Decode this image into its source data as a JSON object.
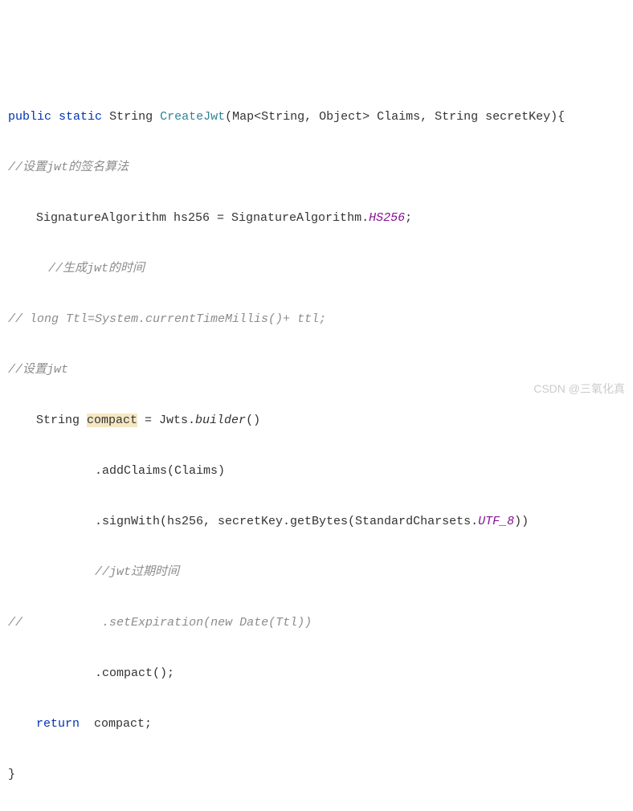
{
  "code": {
    "kw_public": "public",
    "kw_static": "static",
    "type_string": "String",
    "method_name": "CreateJwt",
    "sig_rest": "(Map<String, Object> Claims, String secretKey){",
    "comment_sig_algo": "//设置jwt的签名算法",
    "line_sig_left": "SignatureAlgorithm hs256 = SignatureAlgorithm.",
    "hs256": "HS256",
    "semicolon": ";",
    "comment_gen_time": "//生成jwt的时间",
    "comment_ttl": "// long Ttl=System.currentTimeMillis()+ ttl;",
    "comment_set_jwt": "//设置jwt",
    "decl_compact_left": "String ",
    "compact_word": "compact",
    "eq_jwts": " = Jwts.",
    "builder_call": "builder",
    "paren_empty": "()",
    "addclaims": ".addClaims(Claims)",
    "signwith_left": ".signWith(hs256, secretKey.getBytes(StandardCharsets.",
    "utf8": "UTF_8",
    "close_paren2": "))",
    "comment_expire": "//jwt过期时间",
    "slashslash": "//",
    "setexpiration": ".setExpiration(new Date(Ttl))",
    "compact_call": ".compact();",
    "kw_return": "return",
    "return_rest": "  compact;",
    "close_brace": "}"
  },
  "watermark": "CSDN @三氧化真"
}
